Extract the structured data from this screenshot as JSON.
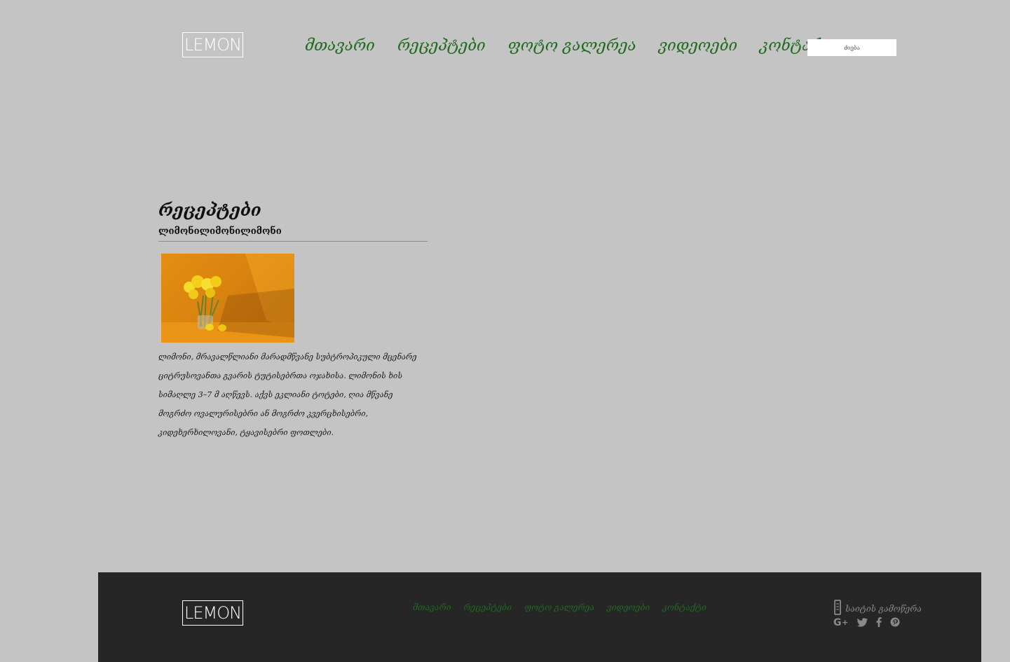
{
  "brand": {
    "logo_text": "LEMON"
  },
  "nav": {
    "items": [
      {
        "label": "მთავარი"
      },
      {
        "label": "რეცეპტები"
      },
      {
        "label": "ფოტო გალერეა"
      },
      {
        "label": "ვიდეოები"
      },
      {
        "label": "კონტაქტი"
      }
    ]
  },
  "search": {
    "placeholder": "ძიება"
  },
  "main": {
    "title": "რეცეპტები",
    "subtitle": "ლიმონილიმონილიმონი",
    "body": "ლიმონი, მრავალწლიანი მარადმწვანე სუბტროპიკული მცენარე ციტრუსოვანთა გვარის ტუტისებრთა ოჯახისა. ლიმონის ხის სიმაღლე 3–7 მ აღწევს. აქვს ეკლიანი ტოტები, ღია მწვანე მოგრძო ოვალურისებრი ან მოგრძო კვერცხისებრი, კიდეხერხილოვანი, ტყავისებრი ფოთლები."
  },
  "footer": {
    "newsletter_label": "საიტის გამოწერა",
    "social_icons": [
      "google-plus-icon",
      "twitter-icon",
      "facebook-icon",
      "pinterest-icon"
    ]
  },
  "colors": {
    "background": "#c4c4c4",
    "nav_link": "#1f6b1f",
    "footer_bg": "#262626",
    "footer_text": "#8a8a8a"
  }
}
